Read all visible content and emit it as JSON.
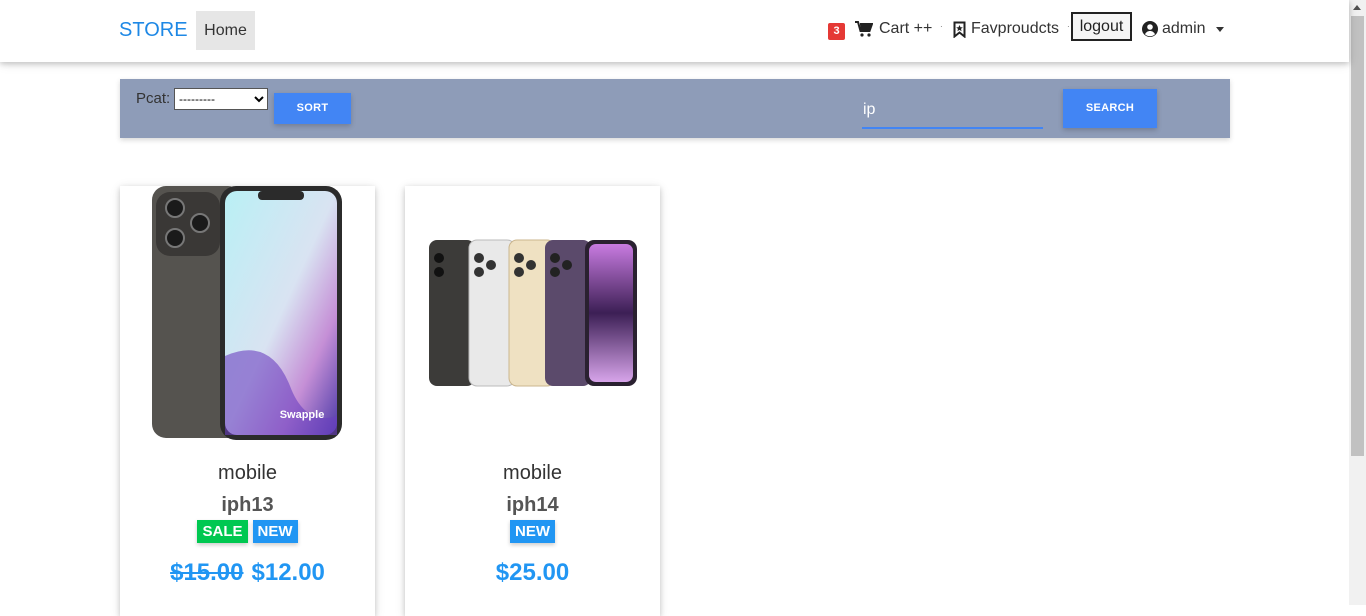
{
  "navbar": {
    "brand": "STORE",
    "home": "Home",
    "cart_count": "3",
    "cart_label": "Cart ++",
    "fav_label": "Favproudcts",
    "logout_label": "logout",
    "user_label": "admin"
  },
  "filters": {
    "pcat_label": "Pcat:",
    "pcat_selected": "---------",
    "sort_label": "SORT",
    "search_value": "ip",
    "search_label": "SEARCH"
  },
  "products": [
    {
      "category": "mobile",
      "name": "iph13",
      "tags": [
        "SALE",
        "NEW"
      ],
      "old_price": "$15.00",
      "price": "$12.00"
    },
    {
      "category": "mobile",
      "name": "iph14",
      "tags": [
        "NEW"
      ],
      "old_price": "",
      "price": "$25.00"
    }
  ],
  "colors": {
    "accent": "#1e88e5",
    "button": "#4285f4",
    "filterbar": "#8e9cb8",
    "sale": "#00c851",
    "new": "#2196f3",
    "badge": "#e53935"
  }
}
